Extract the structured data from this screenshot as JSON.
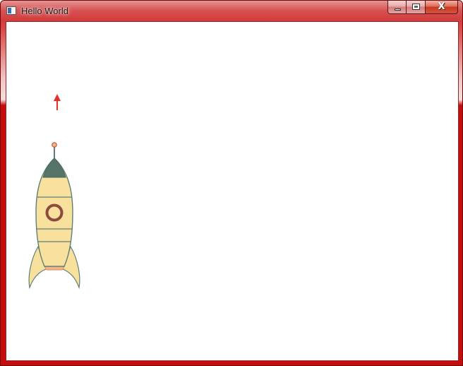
{
  "window": {
    "title": "Hello World",
    "close_glyph": "X"
  },
  "icons": {
    "app": "window-app-icon",
    "minimize": "minimize-icon",
    "maximize": "maximize-icon",
    "close": "close-icon",
    "arrow": "up-arrow-icon",
    "rocket": "rocket-icon"
  },
  "colors": {
    "title_bar_accent": "#c60c0c",
    "rocket_body": "#f7e19d",
    "rocket_outline": "#5f7f78",
    "rocket_nose": "#567468",
    "rocket_window_ring": "#8e4a40",
    "rocket_exhaust": "#f2b48a",
    "arrow": "#e8302a"
  }
}
